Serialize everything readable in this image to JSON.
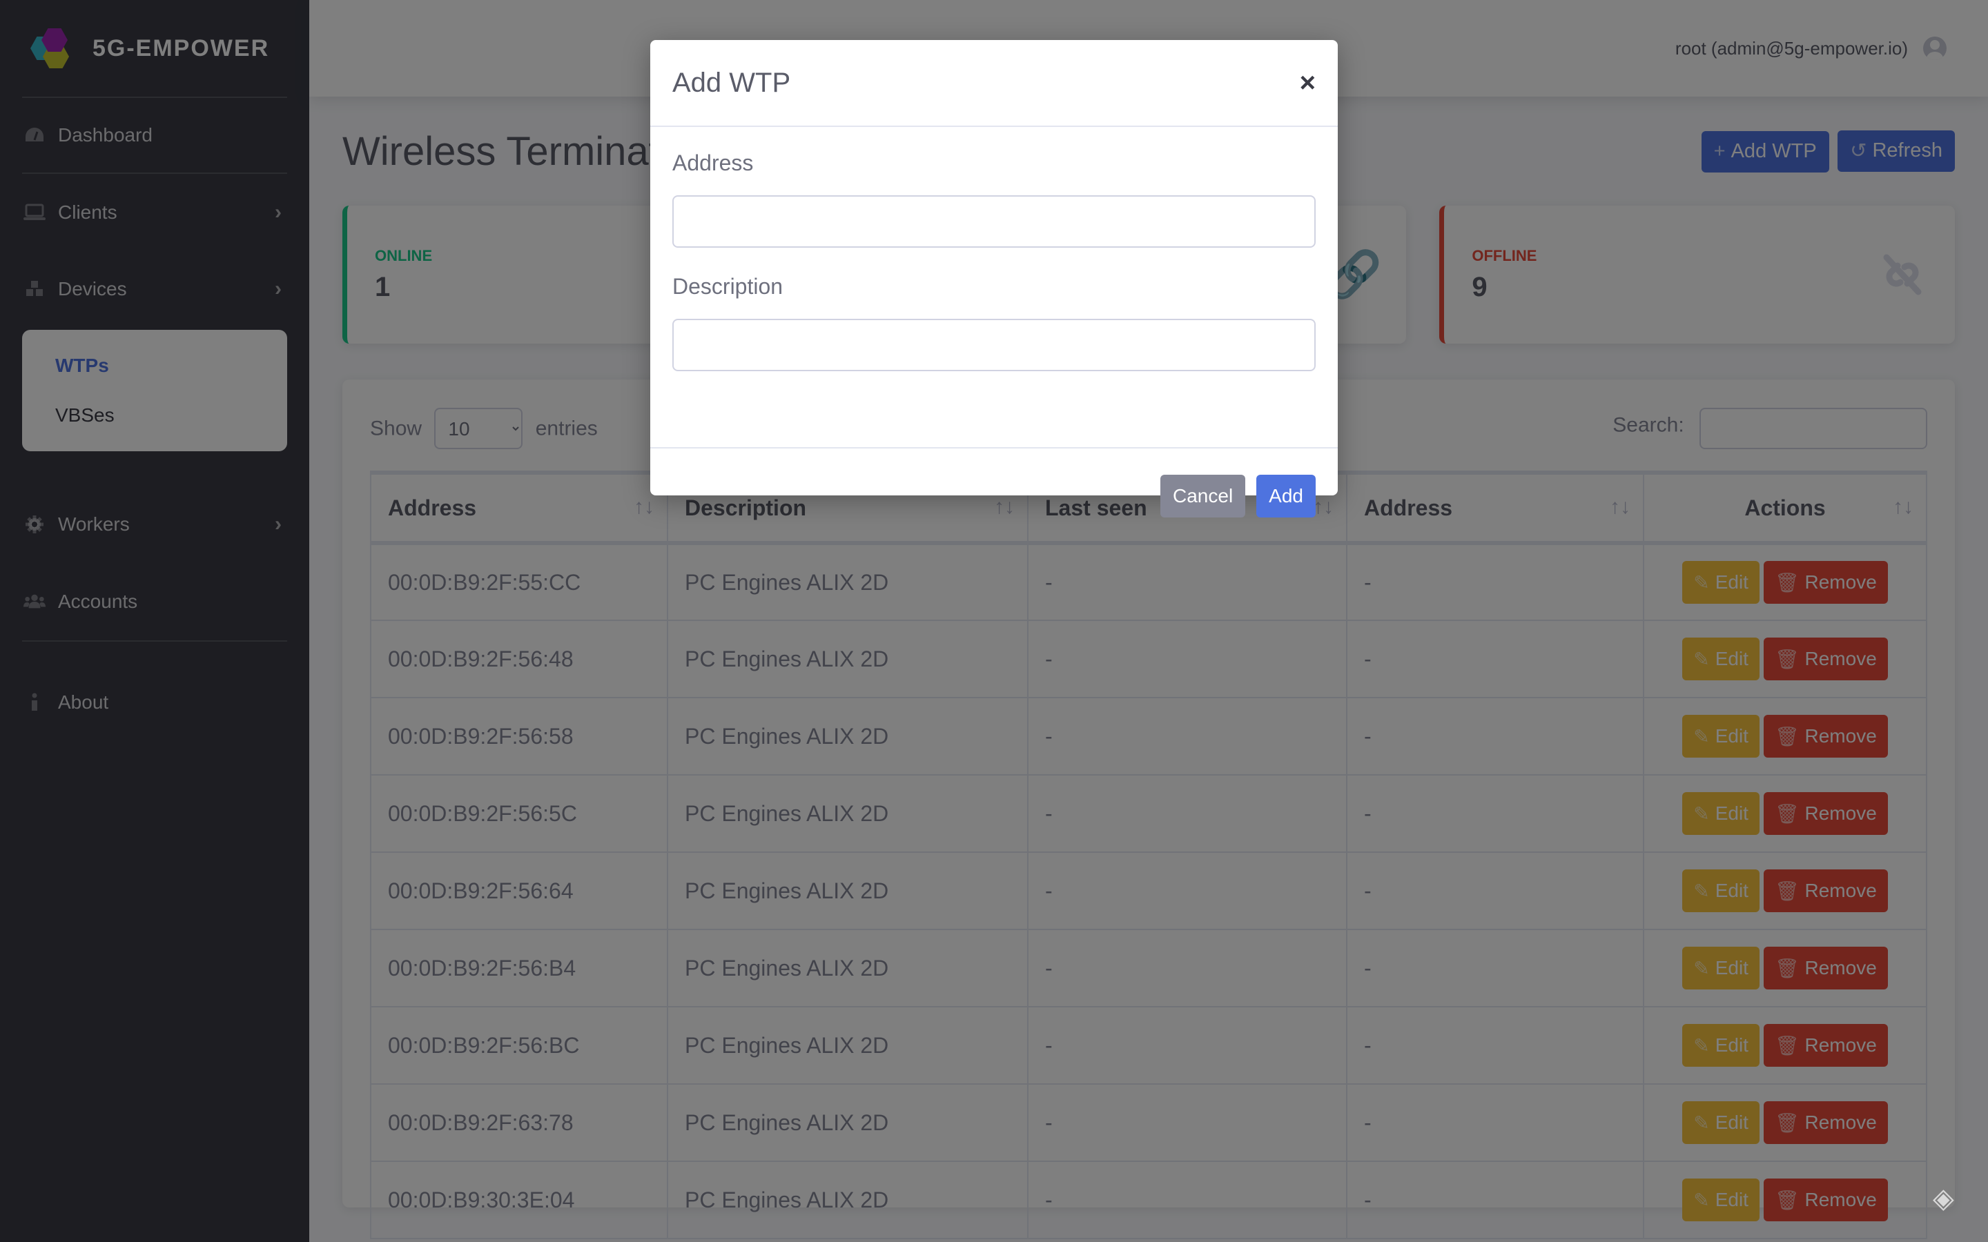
{
  "brand": {
    "name": "5G-EMPOWER",
    "logo_colors": [
      "#36b9cc",
      "#c5c531",
      "#9c27b0"
    ]
  },
  "sidebar": {
    "items": [
      {
        "label": "Dashboard",
        "icon": "tachometer-icon",
        "has_chevron": false
      },
      {
        "label": "Clients",
        "icon": "laptop-icon",
        "has_chevron": true
      },
      {
        "label": "Devices",
        "icon": "cubes-icon",
        "has_chevron": true
      },
      {
        "label": "Workers",
        "icon": "gear-icon",
        "has_chevron": true
      },
      {
        "label": "Accounts",
        "icon": "users-icon",
        "has_chevron": false
      },
      {
        "label": "About",
        "icon": "info-icon",
        "has_chevron": false
      }
    ],
    "devices_submenu": [
      {
        "label": "WTPs",
        "active": true
      },
      {
        "label": "VBSes",
        "active": false
      }
    ]
  },
  "topbar": {
    "user": "root (admin@5g-empower.io)"
  },
  "page": {
    "title": "Wireless Termination Points",
    "add_button": "Add WTP",
    "refresh_button": "Refresh"
  },
  "cards": {
    "online": {
      "label": "ONLINE",
      "value": "1",
      "color": "#1cc88a"
    },
    "offline": {
      "label": "OFFLINE",
      "value": "9",
      "color": "#e74a3b"
    }
  },
  "table": {
    "show_label": "Show",
    "entries_label": "entries",
    "page_size": "10",
    "search_label": "Search:",
    "search_value": "",
    "columns": [
      "Address",
      "Description",
      "Last seen",
      "Address",
      "Actions"
    ],
    "edit_label": "Edit",
    "remove_label": "Remove",
    "rows": [
      {
        "address": "00:0D:B9:2F:55:CC",
        "description": "PC Engines ALIX 2D",
        "last_seen": "-",
        "ip": "-"
      },
      {
        "address": "00:0D:B9:2F:56:48",
        "description": "PC Engines ALIX 2D",
        "last_seen": "-",
        "ip": "-"
      },
      {
        "address": "00:0D:B9:2F:56:58",
        "description": "PC Engines ALIX 2D",
        "last_seen": "-",
        "ip": "-"
      },
      {
        "address": "00:0D:B9:2F:56:5C",
        "description": "PC Engines ALIX 2D",
        "last_seen": "-",
        "ip": "-"
      },
      {
        "address": "00:0D:B9:2F:56:64",
        "description": "PC Engines ALIX 2D",
        "last_seen": "-",
        "ip": "-"
      },
      {
        "address": "00:0D:B9:2F:56:B4",
        "description": "PC Engines ALIX 2D",
        "last_seen": "-",
        "ip": "-"
      },
      {
        "address": "00:0D:B9:2F:56:BC",
        "description": "PC Engines ALIX 2D",
        "last_seen": "-",
        "ip": "-"
      },
      {
        "address": "00:0D:B9:2F:63:78",
        "description": "PC Engines ALIX 2D",
        "last_seen": "-",
        "ip": "-"
      },
      {
        "address": "00:0D:B9:30:3E:04",
        "description": "PC Engines ALIX 2D",
        "last_seen": "-",
        "ip": "-"
      }
    ]
  },
  "modal": {
    "title": "Add WTP",
    "close_symbol": "×",
    "address_label": "Address",
    "address_value": "",
    "description_label": "Description",
    "description_value": "",
    "cancel_button": "Cancel",
    "add_button": "Add"
  }
}
